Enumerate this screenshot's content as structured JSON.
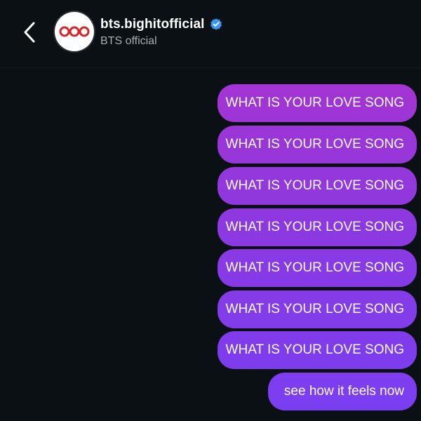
{
  "header": {
    "username": "bts.bighitofficial",
    "display_name": "BTS official"
  },
  "messages": [
    {
      "text": "WHAT IS YOUR LOVE SONG"
    },
    {
      "text": "WHAT IS YOUR LOVE SONG"
    },
    {
      "text": "WHAT IS YOUR LOVE SONG"
    },
    {
      "text": "WHAT IS YOUR LOVE SONG"
    },
    {
      "text": "WHAT IS YOUR LOVE SONG"
    },
    {
      "text": "WHAT IS YOUR LOVE SONG"
    },
    {
      "text": "WHAT IS YOUR LOVE SONG"
    },
    {
      "text": "see how it feels now"
    }
  ],
  "icons": {
    "back": "chevron-left-icon",
    "verified": "verified-badge-icon",
    "avatar": "bighit-logo"
  },
  "colors": {
    "background": "#0b1014",
    "bubble_top": "#a335d3",
    "bubble_bottom": "#7c3df0",
    "verified": "#3897f0"
  }
}
